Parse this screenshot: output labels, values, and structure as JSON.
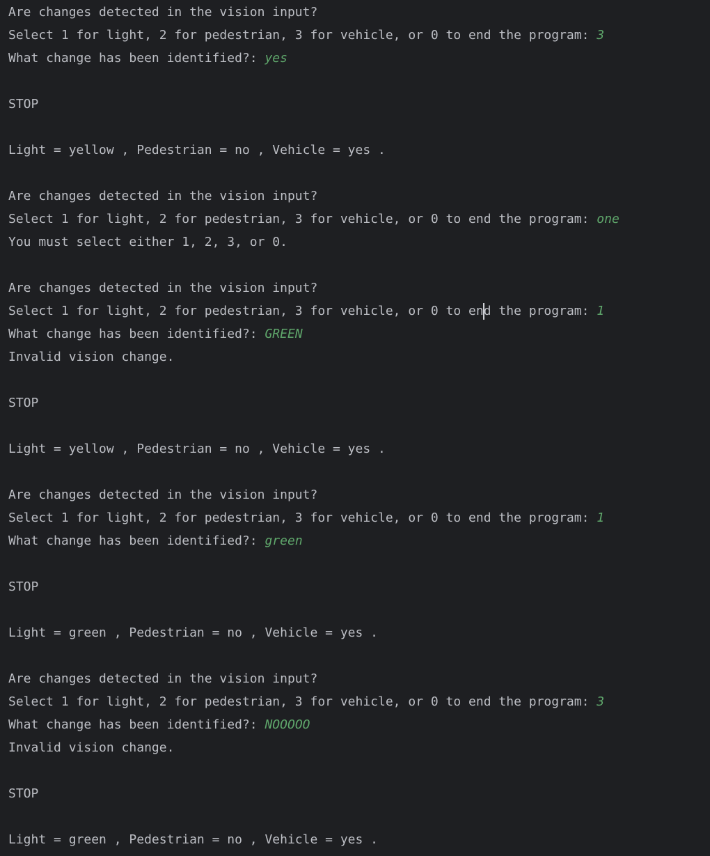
{
  "console": {
    "lines": [
      {
        "text": "Are changes detected in the vision input?"
      },
      {
        "text": "Select 1 for light, 2 for pedestrian, 3 for vehicle, or 0 to end the program: ",
        "input": "3"
      },
      {
        "text": "What change has been identified?: ",
        "input": "yes"
      },
      {
        "text": ""
      },
      {
        "text": "STOP"
      },
      {
        "text": ""
      },
      {
        "text": "Light = yellow , Pedestrian = no , Vehicle = yes ."
      },
      {
        "text": ""
      },
      {
        "text": "Are changes detected in the vision input?"
      },
      {
        "text": "Select 1 for light, 2 for pedestrian, 3 for vehicle, or 0 to end the program: ",
        "input": "one"
      },
      {
        "text": "You must select either 1, 2, 3, or 0."
      },
      {
        "text": ""
      },
      {
        "text": "Are changes detected in the vision input?"
      },
      {
        "text": "Select 1 for light, 2 for pedestrian, 3 for vehicle, or 0 to end the program: ",
        "input": "1",
        "caret_after": "Select 1 for light, 2 for pedestrian, 3 for vehicle, or 0 to en"
      },
      {
        "text": "What change has been identified?: ",
        "input": "GREEN"
      },
      {
        "text": "Invalid vision change."
      },
      {
        "text": ""
      },
      {
        "text": "STOP"
      },
      {
        "text": ""
      },
      {
        "text": "Light = yellow , Pedestrian = no , Vehicle = yes ."
      },
      {
        "text": ""
      },
      {
        "text": "Are changes detected in the vision input?"
      },
      {
        "text": "Select 1 for light, 2 for pedestrian, 3 for vehicle, or 0 to end the program: ",
        "input": "1"
      },
      {
        "text": "What change has been identified?: ",
        "input": "green"
      },
      {
        "text": ""
      },
      {
        "text": "STOP"
      },
      {
        "text": ""
      },
      {
        "text": "Light = green , Pedestrian = no , Vehicle = yes ."
      },
      {
        "text": ""
      },
      {
        "text": "Are changes detected in the vision input?"
      },
      {
        "text": "Select 1 for light, 2 for pedestrian, 3 for vehicle, or 0 to end the program: ",
        "input": "3"
      },
      {
        "text": "What change has been identified?: ",
        "input": "NOOOOO"
      },
      {
        "text": "Invalid vision change."
      },
      {
        "text": ""
      },
      {
        "text": "STOP"
      },
      {
        "text": ""
      },
      {
        "text": "Light = green , Pedestrian = no , Vehicle = yes ."
      }
    ]
  },
  "colors": {
    "background": "#1e1f22",
    "output_text": "#bcbec4",
    "user_input": "#5fa66b",
    "caret": "#cfd1d6"
  }
}
